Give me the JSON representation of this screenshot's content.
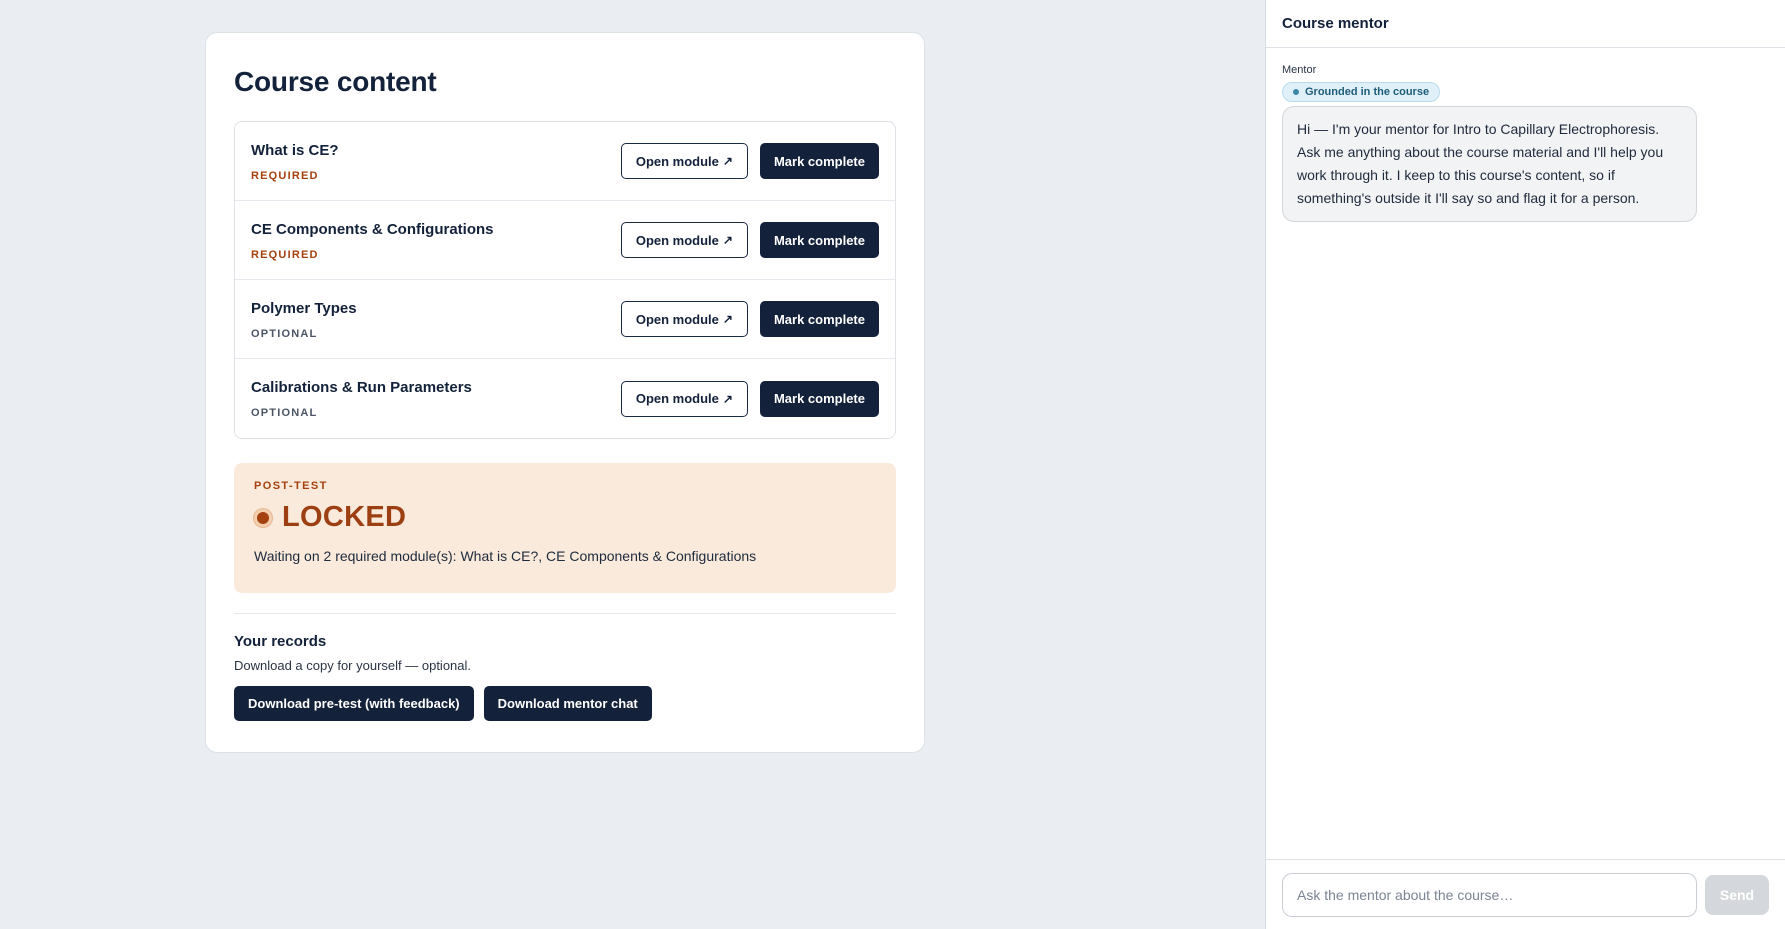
{
  "main": {
    "title": "Course content",
    "modules": [
      {
        "title": "What is CE?",
        "tag": "REQUIRED",
        "open_label": "Open module",
        "complete_label": "Mark complete"
      },
      {
        "title": "CE Components & Configurations",
        "tag": "REQUIRED",
        "open_label": "Open module",
        "complete_label": "Mark complete"
      },
      {
        "title": "Polymer Types",
        "tag": "OPTIONAL",
        "open_label": "Open module",
        "complete_label": "Mark complete"
      },
      {
        "title": "Calibrations & Run Parameters",
        "tag": "OPTIONAL",
        "open_label": "Open module",
        "complete_label": "Mark complete"
      }
    ],
    "post_test": {
      "label": "POST-TEST",
      "status": "LOCKED",
      "message": "Waiting on 2 required module(s): What is CE?, CE Components & Configurations"
    },
    "records": {
      "title": "Your records",
      "subtitle": "Download a copy for yourself — optional.",
      "download_pretest": "Download pre-test (with feedback)",
      "download_chat": "Download mentor chat"
    }
  },
  "mentor": {
    "header": "Course mentor",
    "sender_label": "Mentor",
    "badge": "Grounded in the course",
    "message": "Hi — I'm your mentor for Intro to Capillary Electrophoresis. Ask me anything about the course material and I'll help you work through it. I keep to this course's content, so if something's outside it I'll say so and flag it for a person.",
    "input_placeholder": "Ask the mentor about the course…",
    "send_label": "Send"
  },
  "icons": {
    "external_arrow": "arrow-up-right-icon"
  },
  "colors": {
    "navy": "#13213a",
    "required": "#a5410f",
    "locked_bg": "#f9eadb",
    "badge_bg": "#dff0f8"
  }
}
